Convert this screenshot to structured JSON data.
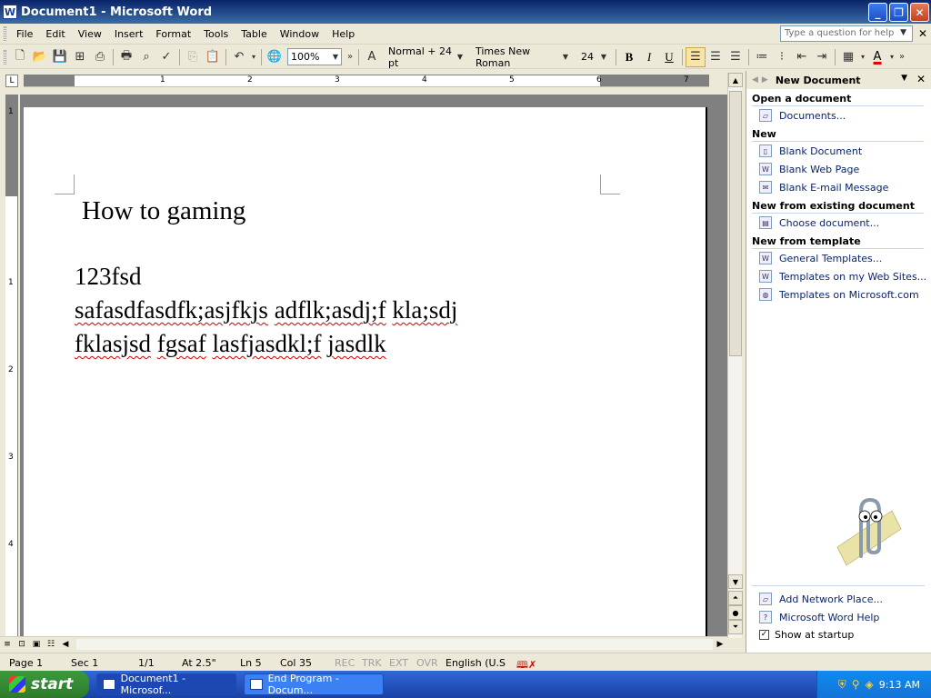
{
  "window": {
    "title": "Document1 - Microsoft Word",
    "app_icon": "W"
  },
  "menu": {
    "items": [
      "File",
      "Edit",
      "View",
      "Insert",
      "Format",
      "Tools",
      "Table",
      "Window",
      "Help"
    ],
    "help_placeholder": "Type a question for help"
  },
  "toolbar": {
    "zoom": "100%",
    "style": "Normal + 24 pt",
    "font": "Times New Roman",
    "size": "24",
    "bold": "B",
    "italic": "I",
    "underline": "U",
    "font_color_glyph": "A"
  },
  "ruler": {
    "h_numbers": [
      "1",
      "2",
      "3",
      "4",
      "5",
      "6",
      "7"
    ],
    "v_numbers": [
      "1",
      "1",
      "2",
      "3",
      "4"
    ]
  },
  "document": {
    "title_line": "How to gaming",
    "line1": "123fsd",
    "line2_words": [
      "safasdfasdfk;asjfkjs",
      "adflk;asdj;f",
      "kla;sdj"
    ],
    "line3_words": [
      "fklasjsd",
      "fgsaf",
      "lasfjasdkl;f",
      "jasdlk"
    ]
  },
  "status": {
    "page": "Page 1",
    "sec": "Sec 1",
    "pages": "1/1",
    "at": "At 2.5\"",
    "ln": "Ln 5",
    "col": "Col 35",
    "rec": "REC",
    "trk": "TRK",
    "ext": "EXT",
    "ovr": "OVR",
    "lang": "English (U.S"
  },
  "taskpane": {
    "title": "New Document",
    "sections": [
      {
        "heading": "Open a document",
        "links": [
          {
            "label": "Documents...",
            "icon": "folder-icon"
          }
        ]
      },
      {
        "heading": "New",
        "links": [
          {
            "label": "Blank Document",
            "icon": "blank-document-icon"
          },
          {
            "label": "Blank Web Page",
            "icon": "web-page-icon"
          },
          {
            "label": "Blank E-mail Message",
            "icon": "email-icon"
          }
        ]
      },
      {
        "heading": "New from existing document",
        "links": [
          {
            "label": "Choose document...",
            "icon": "document-icon"
          }
        ]
      },
      {
        "heading": "New from template",
        "links": [
          {
            "label": "General Templates...",
            "icon": "template-icon"
          },
          {
            "label": "Templates on my Web Sites...",
            "icon": "web-template-icon"
          },
          {
            "label": "Templates on Microsoft.com",
            "icon": "globe-icon"
          }
        ]
      }
    ],
    "footer_links": [
      {
        "label": "Add Network Place...",
        "icon": "network-folder-icon"
      },
      {
        "label": "Microsoft Word Help",
        "icon": "help-icon"
      }
    ],
    "show_at_startup": "Show at startup"
  },
  "taskbar": {
    "start": "start",
    "tasks": [
      "Document1 - Microsof...",
      "End Program - Docum..."
    ],
    "time": "9:13 AM"
  },
  "colors": {
    "titlebar": "#0a246a",
    "taskbar": "#3168d5",
    "link": "#0a246a",
    "squiggle": "#d00000"
  }
}
